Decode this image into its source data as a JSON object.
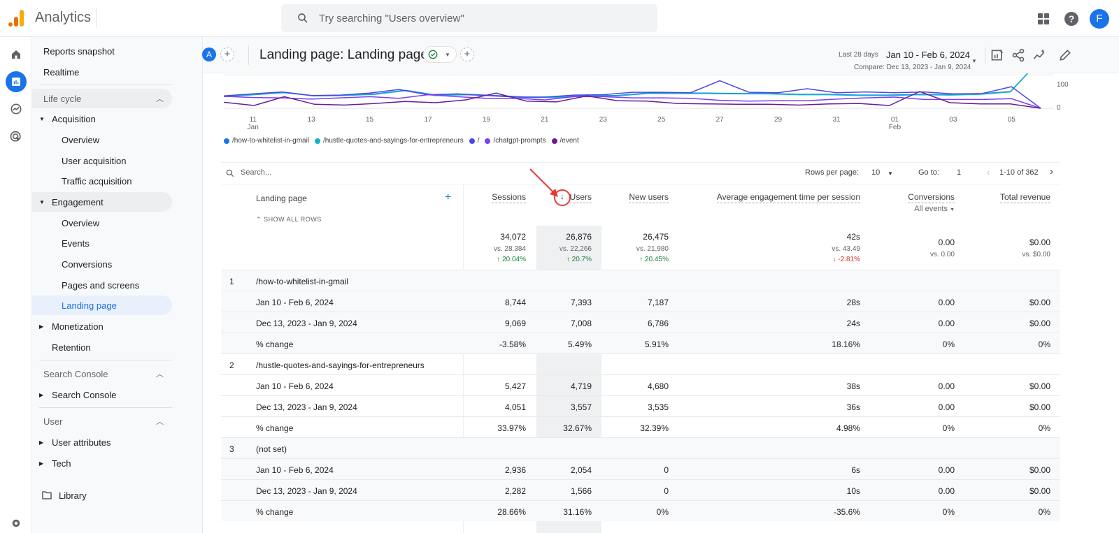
{
  "app": {
    "title": "Analytics",
    "search_placeholder": "Try searching \"Users overview\"",
    "avatar_letter": "F"
  },
  "colors": {
    "accent": "#1a73e8",
    "logo_orange": "#e8710a",
    "logo_yellow": "#f9ab00",
    "positive": "#188038",
    "negative": "#d93025",
    "annotation": "#e53935"
  },
  "rail": {
    "icons": [
      "home-icon",
      "reports-icon",
      "explore-icon",
      "advertising-icon"
    ]
  },
  "sidebar": {
    "top": [
      "Reports snapshot",
      "Realtime"
    ],
    "lifecycle": {
      "header": "Life cycle",
      "acquisition": {
        "label": "Acquisition",
        "items": [
          "Overview",
          "User acquisition",
          "Traffic acquisition"
        ]
      },
      "engagement": {
        "label": "Engagement",
        "items": [
          "Overview",
          "Events",
          "Conversions",
          "Pages and screens",
          "Landing page"
        ]
      },
      "monetization": "Monetization",
      "retention": "Retention"
    },
    "search_console": {
      "header": "Search Console",
      "item": "Search Console"
    },
    "user": {
      "header": "User",
      "items": [
        "User attributes",
        "Tech"
      ]
    },
    "library": "Library"
  },
  "header": {
    "comparison_chip": "A",
    "title": "Landing page: Landing page",
    "date_preset": "Last 28 days",
    "date_range": "Jan 10 - Feb 6, 2024",
    "compare": "Compare: Dec 13, 2023 - Jan 9, 2024"
  },
  "chart_data": {
    "type": "line",
    "x_ticks": [
      "11",
      "13",
      "15",
      "17",
      "19",
      "21",
      "23",
      "25",
      "27",
      "29",
      "31",
      "01",
      "03",
      "05"
    ],
    "x_sublabels": {
      "11": "Jan",
      "01": "Feb"
    },
    "y_ticks": [
      "0",
      "100"
    ],
    "series": [
      {
        "name": "/how-to-whitelist-in-gmail",
        "color": "#1a73e8",
        "values": [
          60,
          70,
          80,
          62,
          64,
          72,
          90,
          66,
          70,
          64,
          56,
          56,
          64,
          64,
          76,
          76,
          76,
          74,
          74,
          70,
          70,
          66,
          66,
          70,
          68,
          72,
          84,
          320
        ]
      },
      {
        "name": "/hustle-quotes-and-sayings-for-entrepreneurs",
        "color": "#12b5cb",
        "values": [
          58,
          68,
          78,
          62,
          64,
          70,
          88,
          64,
          68,
          62,
          54,
          54,
          62,
          62,
          74,
          74,
          74,
          72,
          72,
          68,
          68,
          64,
          64,
          68,
          66,
          70,
          82,
          300
        ]
      },
      {
        "name": "/",
        "color": "#4f46e5",
        "values": [
          62,
          72,
          82,
          64,
          66,
          76,
          94,
          68,
          72,
          64,
          56,
          56,
          66,
          68,
          80,
          80,
          78,
          138,
          80,
          78,
          98,
          78,
          82,
          78,
          82,
          72,
          74,
          108,
          0
        ]
      },
      {
        "name": "/chatgpt-prompts",
        "color": "#7e3ff2",
        "values": [
          60,
          54,
          52,
          46,
          52,
          58,
          50,
          68,
          58,
          50,
          50,
          42,
          58,
          58,
          52,
          52,
          50,
          40,
          36,
          38,
          38,
          46,
          52,
          56,
          44,
          44,
          44,
          48,
          0
        ]
      },
      {
        "name": "/event",
        "color": "#6a1b9a",
        "values": [
          30,
          14,
          58,
          20,
          16,
          24,
          34,
          28,
          42,
          76,
          36,
          32,
          62,
          38,
          36,
          24,
          22,
          20,
          20,
          16,
          22,
          24,
          14,
          84,
          28,
          22,
          22,
          0
        ]
      }
    ],
    "legend_position": "bottom-left"
  },
  "table": {
    "search_placeholder": "Search...",
    "rows_per_page_label": "Rows per page:",
    "rows_per_page": "10",
    "goto_label": "Go to:",
    "goto_value": "1",
    "pagination": "1-10 of 362",
    "dimension_header": "Landing page",
    "show_all_rows": "SHOW ALL ROWS",
    "columns": [
      "Sessions",
      "Users",
      "New users",
      "Average engagement time per session",
      "Conversions",
      "Total revenue"
    ],
    "conversions_filter": "All events",
    "totals": {
      "values": [
        "34,072",
        "26,876",
        "26,475",
        "42s",
        "0.00",
        "$0.00"
      ],
      "compare": [
        "vs. 28,384",
        "vs. 22,266",
        "vs. 21,980",
        "vs. 43.49",
        "vs. 0.00",
        "vs. $0.00"
      ],
      "change": [
        "20.04%",
        "20.7%",
        "20.45%",
        "-2.81%",
        "",
        ""
      ],
      "change_dir": [
        "up",
        "up",
        "up",
        "down",
        "",
        ""
      ]
    },
    "groups": [
      {
        "index": "1",
        "page": "/how-to-whitelist-in-gmail",
        "rows": [
          {
            "label": "Jan 10 - Feb 6, 2024",
            "values": [
              "8,744",
              "7,393",
              "7,187",
              "28s",
              "0.00",
              "$0.00"
            ]
          },
          {
            "label": "Dec 13, 2023 - Jan 9, 2024",
            "values": [
              "9,069",
              "7,008",
              "6,786",
              "24s",
              "0.00",
              "$0.00"
            ]
          },
          {
            "label": "% change",
            "values": [
              "-3.58%",
              "5.49%",
              "5.91%",
              "18.16%",
              "0%",
              "0%"
            ]
          }
        ]
      },
      {
        "index": "2",
        "page": "/hustle-quotes-and-sayings-for-entrepreneurs",
        "rows": [
          {
            "label": "Jan 10 - Feb 6, 2024",
            "values": [
              "5,427",
              "4,719",
              "4,680",
              "38s",
              "0.00",
              "$0.00"
            ]
          },
          {
            "label": "Dec 13, 2023 - Jan 9, 2024",
            "values": [
              "4,051",
              "3,557",
              "3,535",
              "36s",
              "0.00",
              "$0.00"
            ]
          },
          {
            "label": "% change",
            "values": [
              "33.97%",
              "32.67%",
              "32.39%",
              "4.98%",
              "0%",
              "0%"
            ]
          }
        ]
      },
      {
        "index": "3",
        "page": "(not set)",
        "rows": [
          {
            "label": "Jan 10 - Feb 6, 2024",
            "values": [
              "2,936",
              "2,054",
              "0",
              "6s",
              "0.00",
              "$0.00"
            ]
          },
          {
            "label": "Dec 13, 2023 - Jan 9, 2024",
            "values": [
              "2,282",
              "1,566",
              "0",
              "10s",
              "0.00",
              "$0.00"
            ]
          },
          {
            "label": "% change",
            "values": [
              "28.66%",
              "31.16%",
              "0%",
              "-35.6%",
              "0%",
              "0%"
            ]
          }
        ]
      }
    ]
  }
}
